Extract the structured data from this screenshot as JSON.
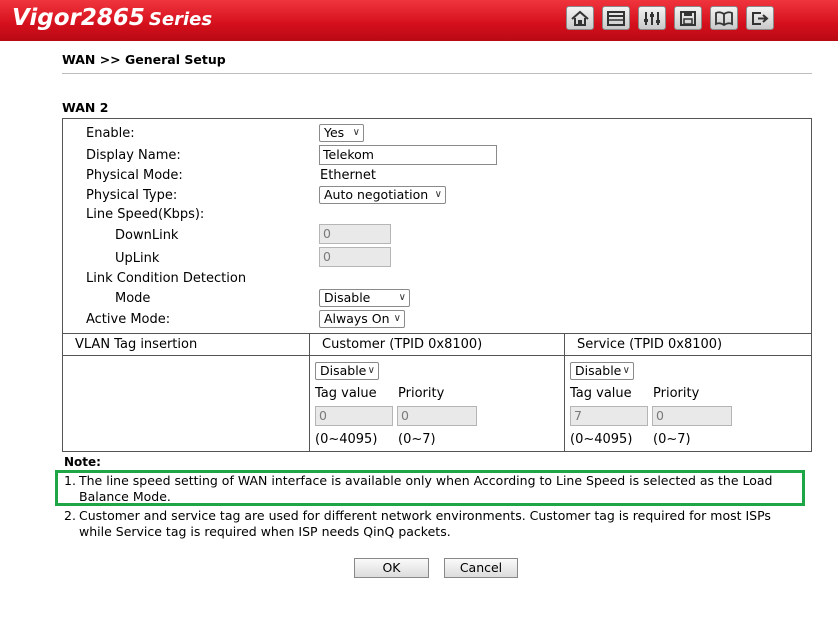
{
  "header": {
    "brand_model": "Vigor2865",
    "brand_series": "Series",
    "toolbar": [
      {
        "name": "home-icon"
      },
      {
        "name": "quick-start-icon"
      },
      {
        "name": "settings-sliders-icon"
      },
      {
        "name": "save-icon"
      },
      {
        "name": "manual-book-icon"
      },
      {
        "name": "logout-icon"
      }
    ]
  },
  "breadcrumb": "WAN >> General Setup",
  "section_title": "WAN 2",
  "form": {
    "enable_label": "Enable:",
    "enable_value": "Yes",
    "display_name_label": "Display Name:",
    "display_name_value": "Telekom",
    "physical_mode_label": "Physical Mode:",
    "physical_mode_value": "Ethernet",
    "physical_type_label": "Physical Type:",
    "physical_type_value": "Auto negotiation",
    "line_speed_label": "Line Speed(Kbps):",
    "downlink_label": "DownLink",
    "downlink_value": "0",
    "uplink_label": "UpLink",
    "uplink_value": "0",
    "link_detect_label": "Link Condition Detection",
    "mode_label": "Mode",
    "mode_value": "Disable",
    "active_mode_label": "Active Mode:",
    "active_mode_value": "Always On"
  },
  "vlan": {
    "header_label": "VLAN Tag insertion",
    "customer": {
      "header": "Customer (TPID 0x8100)",
      "select_value": "Disable",
      "tag_label": "Tag value",
      "priority_label": "Priority",
      "tag_value": "0",
      "priority_value": "0",
      "tag_range": "(0~4095)",
      "priority_range": "(0~7)"
    },
    "service": {
      "header": "Service (TPID 0x8100)",
      "select_value": "Disable",
      "tag_label": "Tag value",
      "priority_label": "Priority",
      "tag_value": "7",
      "priority_value": "0",
      "tag_range": "(0~4095)",
      "priority_range": "(0~7)"
    }
  },
  "notes": {
    "title": "Note:",
    "items": [
      {
        "num": "1.",
        "text": "The line speed setting of WAN interface is available only when According to Line Speed is selected as the Load Balance Mode."
      },
      {
        "num": "2.",
        "text": "Customer and service tag are used for different network environments. Customer tag is required for most ISPs while Service tag is required when ISP needs QinQ packets."
      }
    ]
  },
  "buttons": {
    "ok": "OK",
    "cancel": "Cancel"
  },
  "colors": {
    "header_red": "#d40f1c",
    "highlight_green": "#1ea646"
  }
}
